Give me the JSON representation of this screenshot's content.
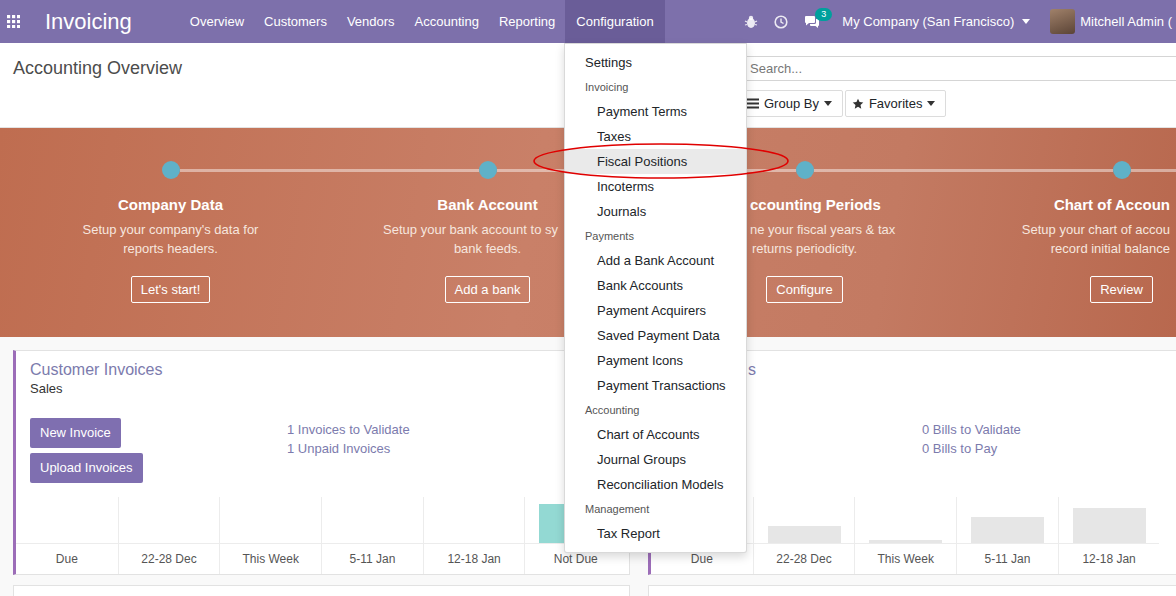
{
  "navbar": {
    "app_title": "Invoicing",
    "menu": [
      {
        "label": "Overview",
        "selected": false
      },
      {
        "label": "Customers",
        "selected": false
      },
      {
        "label": "Vendors",
        "selected": false
      },
      {
        "label": "Accounting",
        "selected": false
      },
      {
        "label": "Reporting",
        "selected": false
      },
      {
        "label": "Configuration",
        "selected": true
      }
    ],
    "chat_badge": "3",
    "company": "My Company (San Francisco)",
    "user": "Mitchell Admin ("
  },
  "control_panel": {
    "title": "Accounting Overview",
    "search": {
      "placeholder": "Search..."
    },
    "buttons": [
      "Group By",
      "Favorites"
    ]
  },
  "onboarding": {
    "steps": [
      {
        "title": "Company Data",
        "description": [
          "Setup your company's data for",
          "reports headers."
        ],
        "button": "Let's start!"
      },
      {
        "title": "Bank Account",
        "description": [
          "Setup your bank account to sy",
          "bank feeds."
        ],
        "button": "Add a bank"
      },
      {
        "title": "ccounting Periods",
        "description": [
          "ne your fiscal years & tax",
          "returns periodicity."
        ],
        "button": "Configure"
      },
      {
        "title": "Chart of Accoun",
        "description": [
          "Setup your chart of accou",
          "record initial balance"
        ],
        "button": "Review"
      }
    ]
  },
  "dashboards": [
    {
      "title": "Customer Invoices",
      "subtitle": "Sales",
      "buttons": [
        "New Invoice",
        "Upload Invoices"
      ],
      "links": [
        "1 Invoices to Validate",
        "1 Unpaid Invoices"
      ],
      "chart": {
        "labels": [
          "Due",
          "22-28 Dec",
          "This Week",
          "5-11 Jan",
          "12-18 Jan",
          "Not Due"
        ],
        "values": [
          0,
          0,
          0,
          0,
          0,
          39
        ],
        "color": "#93d9d3"
      }
    },
    {
      "title": "s",
      "buttons": [],
      "links": [
        "0 Bills to Validate",
        "0 Bills to Pay"
      ],
      "chart": {
        "labels": [
          "Due",
          "22-28 Dec",
          "This Week",
          "5-11 Jan",
          "12-18 Jan"
        ],
        "values": [
          0,
          17,
          3,
          26,
          35
        ],
        "color": "#e6e6e6"
      }
    }
  ],
  "config_menu": {
    "items": [
      {
        "kind": "item",
        "label": "Settings",
        "selected": false,
        "circled": false
      },
      {
        "kind": "header",
        "label": "Invoicing"
      },
      {
        "kind": "subitem",
        "label": "Payment Terms",
        "selected": false,
        "circled": false
      },
      {
        "kind": "subitem",
        "label": "Taxes",
        "selected": false,
        "circled": false
      },
      {
        "kind": "subitem",
        "label": "Fiscal Positions",
        "selected": true,
        "circled": true
      },
      {
        "kind": "subitem",
        "label": "Incoterms",
        "selected": false,
        "circled": false
      },
      {
        "kind": "subitem",
        "label": "Journals",
        "selected": false,
        "circled": false
      },
      {
        "kind": "header",
        "label": "Payments"
      },
      {
        "kind": "subitem",
        "label": "Add a Bank Account",
        "selected": false,
        "circled": false
      },
      {
        "kind": "subitem",
        "label": "Bank Accounts",
        "selected": false,
        "circled": false
      },
      {
        "kind": "subitem",
        "label": "Payment Acquirers",
        "selected": false,
        "circled": false
      },
      {
        "kind": "subitem",
        "label": "Saved Payment Data",
        "selected": false,
        "circled": false
      },
      {
        "kind": "subitem",
        "label": "Payment Icons",
        "selected": false,
        "circled": false
      },
      {
        "kind": "subitem",
        "label": "Payment Transactions",
        "selected": false,
        "circled": false
      },
      {
        "kind": "header",
        "label": "Accounting"
      },
      {
        "kind": "subitem",
        "label": "Chart of Accounts",
        "selected": false,
        "circled": false
      },
      {
        "kind": "subitem",
        "label": "Journal Groups",
        "selected": false,
        "circled": false
      },
      {
        "kind": "subitem",
        "label": "Reconciliation Models",
        "selected": false,
        "circled": false
      },
      {
        "kind": "header",
        "label": "Management"
      },
      {
        "kind": "subitem",
        "label": "Tax Report",
        "selected": false,
        "circled": false
      }
    ]
  }
}
